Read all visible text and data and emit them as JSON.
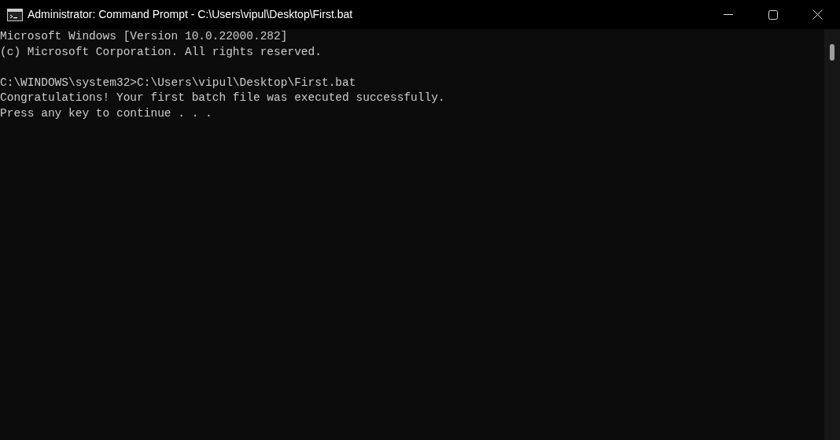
{
  "window": {
    "title": "Administrator: Command Prompt - C:\\Users\\vipul\\Desktop\\First.bat"
  },
  "console": {
    "blocks": [
      [
        "Microsoft Windows [Version 10.0.22000.282]",
        "(c) Microsoft Corporation. All rights reserved."
      ],
      [
        "C:\\WINDOWS\\system32>C:\\Users\\vipul\\Desktop\\First.bat",
        "Congratulations! Your first batch file was executed successfully.",
        "Press any key to continue . . ."
      ]
    ]
  }
}
